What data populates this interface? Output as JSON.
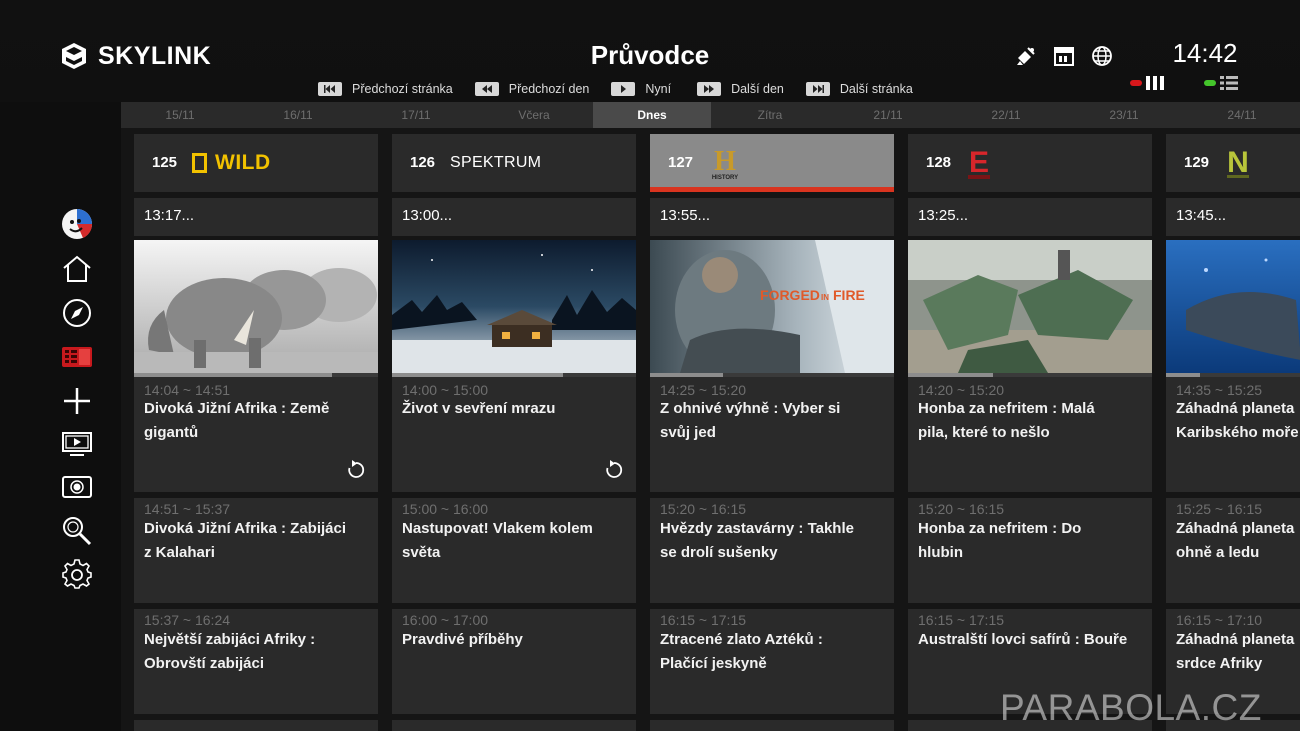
{
  "header": {
    "brand": "SKYLINK",
    "title": "Průvodce",
    "clock": "14:42",
    "status_icons": [
      "satellite-icon",
      "calendar-icon",
      "globe-icon"
    ],
    "view_mode_colors": [
      "#d8171b",
      "#44c52b"
    ]
  },
  "nav_hints": [
    {
      "key": "skip-back",
      "label": "Předchozí stránka"
    },
    {
      "key": "rewind",
      "label": "Předchozí den"
    },
    {
      "key": "play",
      "label": "Nyní"
    },
    {
      "key": "forward",
      "label": "Další den"
    },
    {
      "key": "skip-forward",
      "label": "Další stránka"
    }
  ],
  "dates": [
    "15/11",
    "16/11",
    "17/11",
    "Včera",
    "Dnes",
    "Zítra",
    "21/11",
    "22/11",
    "23/11",
    "24/11"
  ],
  "active_date_index": 4,
  "sidebar_icons": [
    "profile-icon",
    "home-icon",
    "compass-icon",
    "tv-guide-icon",
    "add-icon",
    "live-tv-icon",
    "recordings-icon",
    "search-icon",
    "settings-icon"
  ],
  "channels": [
    {
      "number": "125",
      "logo": "WILD",
      "now": "13:17...",
      "programs": [
        {
          "time": "14:04 ~ 14:51",
          "title": [
            "Divoká Jižní Afrika : Země",
            "gigantů"
          ],
          "progress": 0.81,
          "replay": true
        },
        {
          "time": "14:51 ~ 15:37",
          "title": [
            "Divoká Jižní Afrika : Zabijáci",
            "z Kalahari"
          ]
        },
        {
          "time": "15:37 ~ 16:24",
          "title": [
            "Největší zabijáci Afriky :",
            "Obrovští zabijáci"
          ]
        }
      ]
    },
    {
      "number": "126",
      "logo": "SPEKTRUM",
      "now": "13:00...",
      "programs": [
        {
          "time": "14:00 ~ 15:00",
          "title": [
            "Život v sevření mrazu",
            ""
          ],
          "progress": 0.7,
          "replay": true
        },
        {
          "time": "15:00 ~ 16:00",
          "title": [
            "Nastupovat! Vlakem kolem",
            "světa"
          ]
        },
        {
          "time": "16:00 ~ 17:00",
          "title": [
            "Pravdivé příběhy",
            ""
          ]
        }
      ]
    },
    {
      "number": "127",
      "logo": "HISTORY",
      "now": "13:55...",
      "programs": [
        {
          "time": "14:25 ~ 15:20",
          "title": [
            "Z ohnivé výhně : Vyber si",
            "svůj jed"
          ],
          "progress": 0.3,
          "replay": false
        },
        {
          "time": "15:20 ~ 16:15",
          "title": [
            "Hvězdy zastavárny : Takhle",
            "se drolí sušenky"
          ]
        },
        {
          "time": "16:15 ~ 17:15",
          "title": [
            "Ztracené zlato Aztéků :",
            "Plačící jeskyně"
          ]
        }
      ]
    },
    {
      "number": "128",
      "logo": "E",
      "now": "13:25...",
      "programs": [
        {
          "time": "14:20 ~ 15:20",
          "title": [
            "Honba za nefritem : Malá",
            "pila, které to nešlo"
          ],
          "progress": 0.35,
          "replay": false
        },
        {
          "time": "15:20 ~ 16:15",
          "title": [
            "Honba za nefritem : Do",
            "hlubin"
          ]
        },
        {
          "time": "16:15 ~ 17:15",
          "title": [
            "Australští lovci safírů : Bouře",
            ""
          ]
        }
      ]
    },
    {
      "number": "129",
      "logo": "N",
      "now": "13:45...",
      "programs": [
        {
          "time": "14:35 ~ 15:25",
          "title": [
            "Záhadná planeta",
            "Karibského moře"
          ],
          "progress": 0.14,
          "replay": false
        },
        {
          "time": "15:25 ~ 16:15",
          "title": [
            "Záhadná planeta",
            "ohně a ledu"
          ]
        },
        {
          "time": "16:15 ~ 17:10",
          "title": [
            "Záhadná planeta",
            "srdce Afriky"
          ]
        }
      ]
    }
  ],
  "active_channel_index": 2,
  "watermark": "PARABOLA.CZ"
}
